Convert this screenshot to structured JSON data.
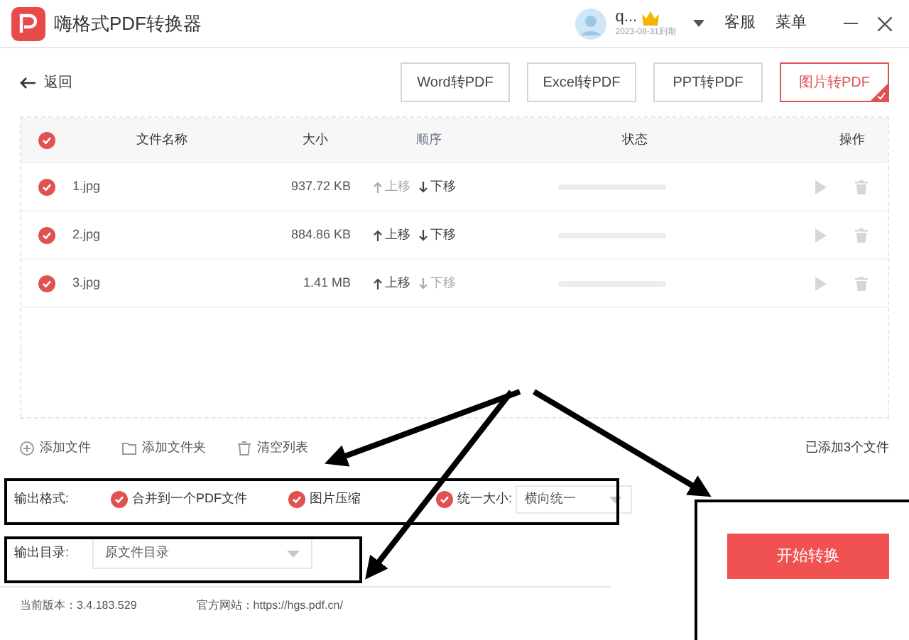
{
  "app": {
    "title": "嗨格式PDF转换器",
    "user": "q...",
    "expiry": "2023-08-31到期",
    "menu": [
      "客服",
      "菜单"
    ]
  },
  "back": "返回",
  "tabs": [
    {
      "label": "Word转PDF",
      "selected": false
    },
    {
      "label": "Excel转PDF",
      "selected": false
    },
    {
      "label": "PPT转PDF",
      "selected": false
    },
    {
      "label": "图片转PDF",
      "selected": true
    }
  ],
  "table": {
    "all_checked": true,
    "columns": [
      "文件名称",
      "大小",
      "顺序",
      "状态",
      "操作"
    ],
    "rows": [
      {
        "checked": true,
        "name": "1.jpg",
        "size": "937.72 KB",
        "up": "上移",
        "up_disabled": true,
        "down": "下移",
        "down_disabled": false
      },
      {
        "checked": true,
        "name": "2.jpg",
        "size": "884.86 KB",
        "up": "上移",
        "up_disabled": false,
        "down": "下移",
        "down_disabled": false
      },
      {
        "checked": true,
        "name": "3.jpg",
        "size": "1.41 MB",
        "up": "上移",
        "up_disabled": false,
        "down": "下移",
        "down_disabled": true
      }
    ]
  },
  "actions": [
    "添加文件",
    "添加文件夹",
    "清空列表"
  ],
  "count": "已添加3个文件",
  "output_format": {
    "label": "输出格式:",
    "options": [
      {
        "label": "合并到一个PDF文件",
        "checked": true
      },
      {
        "label": "图片压缩",
        "checked": true
      },
      {
        "label": "统一大小:",
        "checked": true
      }
    ],
    "size_value": "横向统一"
  },
  "output_dir": {
    "label": "输出目录:",
    "value": "原文件目录"
  },
  "start": "开始转换",
  "footer": {
    "version": "当前版本：3.4.183.529",
    "site": "官方网站：https://hgs.pdf.cn/"
  }
}
